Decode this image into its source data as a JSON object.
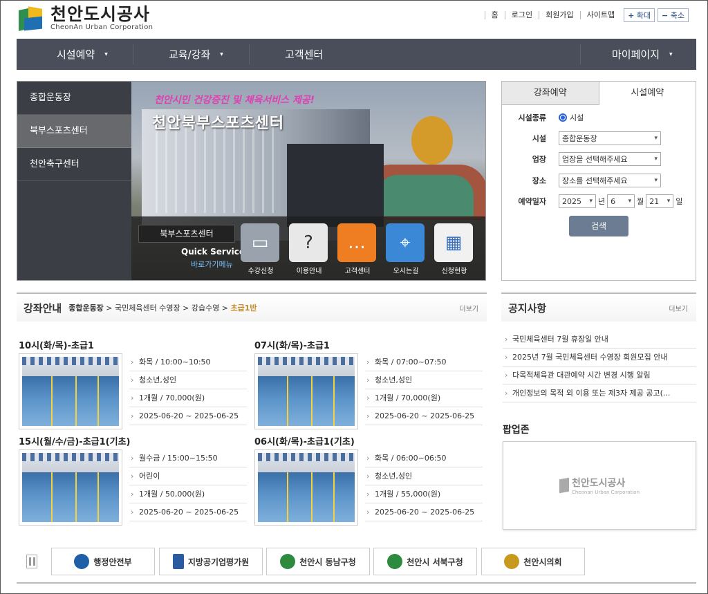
{
  "header": {
    "logo_kor": "천안도시공사",
    "logo_eng": "CheonAn Urban Corporation",
    "util_links": [
      "홈",
      "로그인",
      "회원가입",
      "사이트맵"
    ],
    "zoom_in": "확대",
    "zoom_out": "축소"
  },
  "nav": {
    "items": [
      "시설예약",
      "교육/강좌",
      "고객센터",
      "마이페이지"
    ]
  },
  "hero": {
    "side_items": [
      "종합운동장",
      "북부스포츠센터",
      "천안축구센터"
    ],
    "tagline": "천안시민 건강증진 및 체육서비스 제공!",
    "title": "천안북부스포츠센터",
    "qs_name": "북부스포츠센터",
    "qs_en": "Quick Service",
    "qs_kr": "바로가기메뉴",
    "quick": [
      {
        "label": "수강신청",
        "icon": "monitor-icon",
        "color": "#9aa3ad"
      },
      {
        "label": "이용안내",
        "icon": "info-icon",
        "color": "#e8e8e8"
      },
      {
        "label": "고객센터",
        "icon": "chat-icon",
        "color": "#ef7d22"
      },
      {
        "label": "오시는길",
        "icon": "map-icon",
        "color": "#3a88d6"
      },
      {
        "label": "신청현황",
        "icon": "apps-icon",
        "color": "#f1f1f1"
      }
    ]
  },
  "reservation": {
    "tab_course": "강좌예약",
    "tab_facility": "시설예약",
    "type_label": "시설종류",
    "type_value": "시설",
    "facility_label": "시설",
    "facility_value": "종합운동장",
    "venue_label": "업장",
    "venue_placeholder": "업장을 선택해주세요",
    "place_label": "장소",
    "place_placeholder": "장소를 선택해주세요",
    "date_label": "예약일자",
    "year": "2025",
    "year_unit": "년",
    "month": "6",
    "month_unit": "월",
    "day": "21",
    "day_unit": "일",
    "search": "검색"
  },
  "courses": {
    "title": "강좌안내",
    "crumb_1": "종합운동장",
    "crumb_2": "국민체육센터 수영장",
    "crumb_3": "강습수영",
    "crumb_current": "초급1반",
    "more": "더보기",
    "items": [
      {
        "title": "10시(화/목)-초급1",
        "time": "화목 / 10:00~10:50",
        "target": "청소년,성인",
        "fee": "1개월 / 70,000(원)",
        "period": "2025-06-20 ~ 2025-06-25"
      },
      {
        "title": "07시(화/목)-초급1",
        "time": "화목 / 07:00~07:50",
        "target": "청소년,성인",
        "fee": "1개월 / 70,000(원)",
        "period": "2025-06-20 ~ 2025-06-25"
      },
      {
        "title": "15시(월/수/금)-초급1(기초)",
        "time": "월수금 / 15:00~15:50",
        "target": "어린이",
        "fee": "1개월 / 50,000(원)",
        "period": "2025-06-20 ~ 2025-06-25"
      },
      {
        "title": "06시(화/목)-초급1(기초)",
        "time": "화목 / 06:00~06:50",
        "target": "청소년,성인",
        "fee": "1개월 / 55,000(원)",
        "period": "2025-06-20 ~ 2025-06-25"
      }
    ]
  },
  "notices": {
    "title": "공지사항",
    "more": "더보기",
    "items": [
      "국민체육센터 7월 휴장일 안내",
      "2025년 7월 국민체육센터 수영장 회원모집 안내",
      "다목적체육관 대관예약 시간 변경 시행 알림",
      "개인정보의 목적 외 이용 또는 제3자 제공 공고(..."
    ]
  },
  "popup": {
    "title": "팝업존",
    "logo_kor": "천안도시공사",
    "logo_eng": "Cheonan Urban Corporation"
  },
  "banners": [
    {
      "label": "행정안전부",
      "color": "#1f5fa8"
    },
    {
      "label": "지방공기업평가원",
      "color": "#2a5aa0"
    },
    {
      "label": "천안시 동남구청",
      "color": "#2d8a3e"
    },
    {
      "label": "천안시 서북구청",
      "color": "#2d8a3e"
    },
    {
      "label": "천안시의회",
      "color": "#c79a1e"
    }
  ]
}
